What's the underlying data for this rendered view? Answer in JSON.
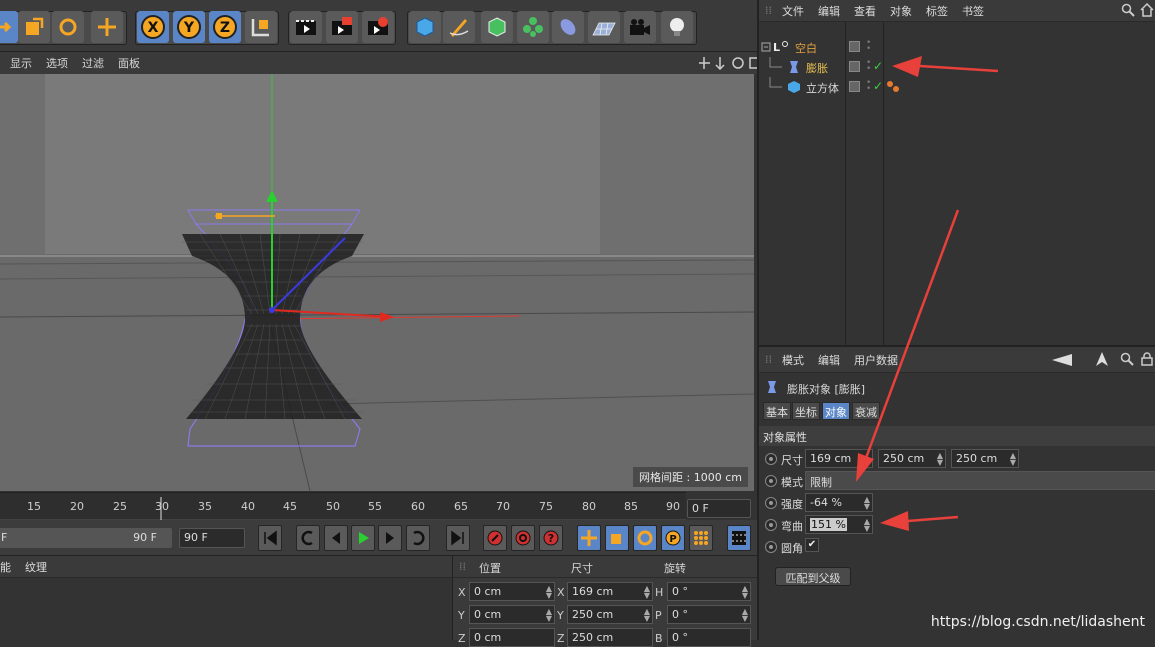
{
  "viewport_menu": [
    "显示",
    "选项",
    "过滤",
    "面板"
  ],
  "grid_spacing": "网格间距 : 1000 cm",
  "timeline": {
    "ticks": [
      "15",
      "20",
      "25",
      "30",
      "35",
      "40",
      "45",
      "50",
      "55",
      "60",
      "65",
      "70",
      "75",
      "80",
      "85",
      "90"
    ],
    "current_frame": "0 F",
    "range_end": "90 F",
    "end_frame": "90 F"
  },
  "material_menu": [
    "能",
    "纹理"
  ],
  "coords": {
    "headers": [
      "位置",
      "尺寸",
      "旋转"
    ],
    "rows": [
      {
        "a": "X",
        "pos": "0 cm",
        "b": "X",
        "size": "169 cm",
        "c": "H",
        "rot": "0 °"
      },
      {
        "a": "Y",
        "pos": "0 cm",
        "b": "Y",
        "size": "250 cm",
        "c": "P",
        "rot": "0 °"
      },
      {
        "a": "Z",
        "pos": "0 cm",
        "b": "Z",
        "size": "250 cm",
        "c": "B",
        "rot": "0 °"
      }
    ]
  },
  "object_manager": {
    "menu": [
      "文件",
      "编辑",
      "查看",
      "对象",
      "标签",
      "书签"
    ],
    "objects": [
      {
        "name": "空白",
        "color": "#e0a040"
      },
      {
        "name": "膨胀",
        "color": "#e8c050"
      },
      {
        "name": "立方体",
        "color": "#d8d8d8"
      }
    ]
  },
  "attributes": {
    "menu": [
      "模式",
      "编辑",
      "用户数据"
    ],
    "title": "膨胀对象 [膨胀]",
    "tabs": [
      "基本",
      "坐标",
      "对象",
      "衰减"
    ],
    "section": "对象属性",
    "size_label": "尺寸",
    "size": [
      "169 cm",
      "250 cm",
      "250 cm"
    ],
    "mode_label": "模式",
    "mode": "限制",
    "strength_label": "强度",
    "strength": "-64 %",
    "curvature_label": "弯曲",
    "curvature": "151 %",
    "round_label": "圆角",
    "round_check": "✔",
    "fit_button": "匹配到父级"
  },
  "watermark": "https://blog.csdn.net/lidashent",
  "accent": "#5a86c8",
  "arrow_color": "#e8403a"
}
